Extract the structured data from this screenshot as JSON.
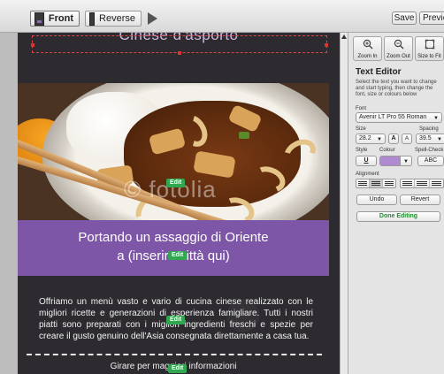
{
  "toolbar": {
    "tab_front": "Front",
    "tab_reverse": "Reverse",
    "save_label": "Save",
    "preview_label": "Preview"
  },
  "card": {
    "header_text": "Cinese d'asporto",
    "photo_watermark": "© fotolia",
    "banner_line1": "Portando un assaggio di Oriente",
    "banner_line2": "a (inserire città qui)",
    "body_text": "Offriamo un menù vasto e vario di cucina cinese realizzato con le migliori ricette e generazioni di esperienza famigliare. Tutti i nostri piatti sono preparati con i migliori ingredienti freschi e spezie per creare il gusto genuino dell'Asia consegnata direttamente a casa tua.",
    "more_info": "Girare per maggiori informazioni",
    "edit_label": "Edit",
    "colors": {
      "banner": "#7d56a8",
      "background": "#2d2b30",
      "edit_badge": "#2fa84f"
    }
  },
  "panel": {
    "zoom_in": "Zoom In",
    "zoom_out": "Zoom Out",
    "size_to_fit": "Size to Fit",
    "title": "Text Editor",
    "hint": "Select the text you want to change and start typing, then change the font, size or colours below",
    "font_label": "Font",
    "font_value": "Avenir LT Pro 55 Roman",
    "size_label": "Size",
    "size_value": "28.2",
    "spacing_label": "Spacing",
    "spacing_value": "39.5",
    "style_label": "Style",
    "colour_label": "Colour",
    "spellcheck_label": "Spell-Check",
    "underline_label": "U",
    "size_up_label": "A",
    "size_down_label": "A",
    "abc_label": "ABC",
    "alignment_label": "Alignment",
    "undo_label": "Undo",
    "revert_label": "Revert",
    "done_label": "Done Editing",
    "colour_swatch": "#b08ad0"
  }
}
